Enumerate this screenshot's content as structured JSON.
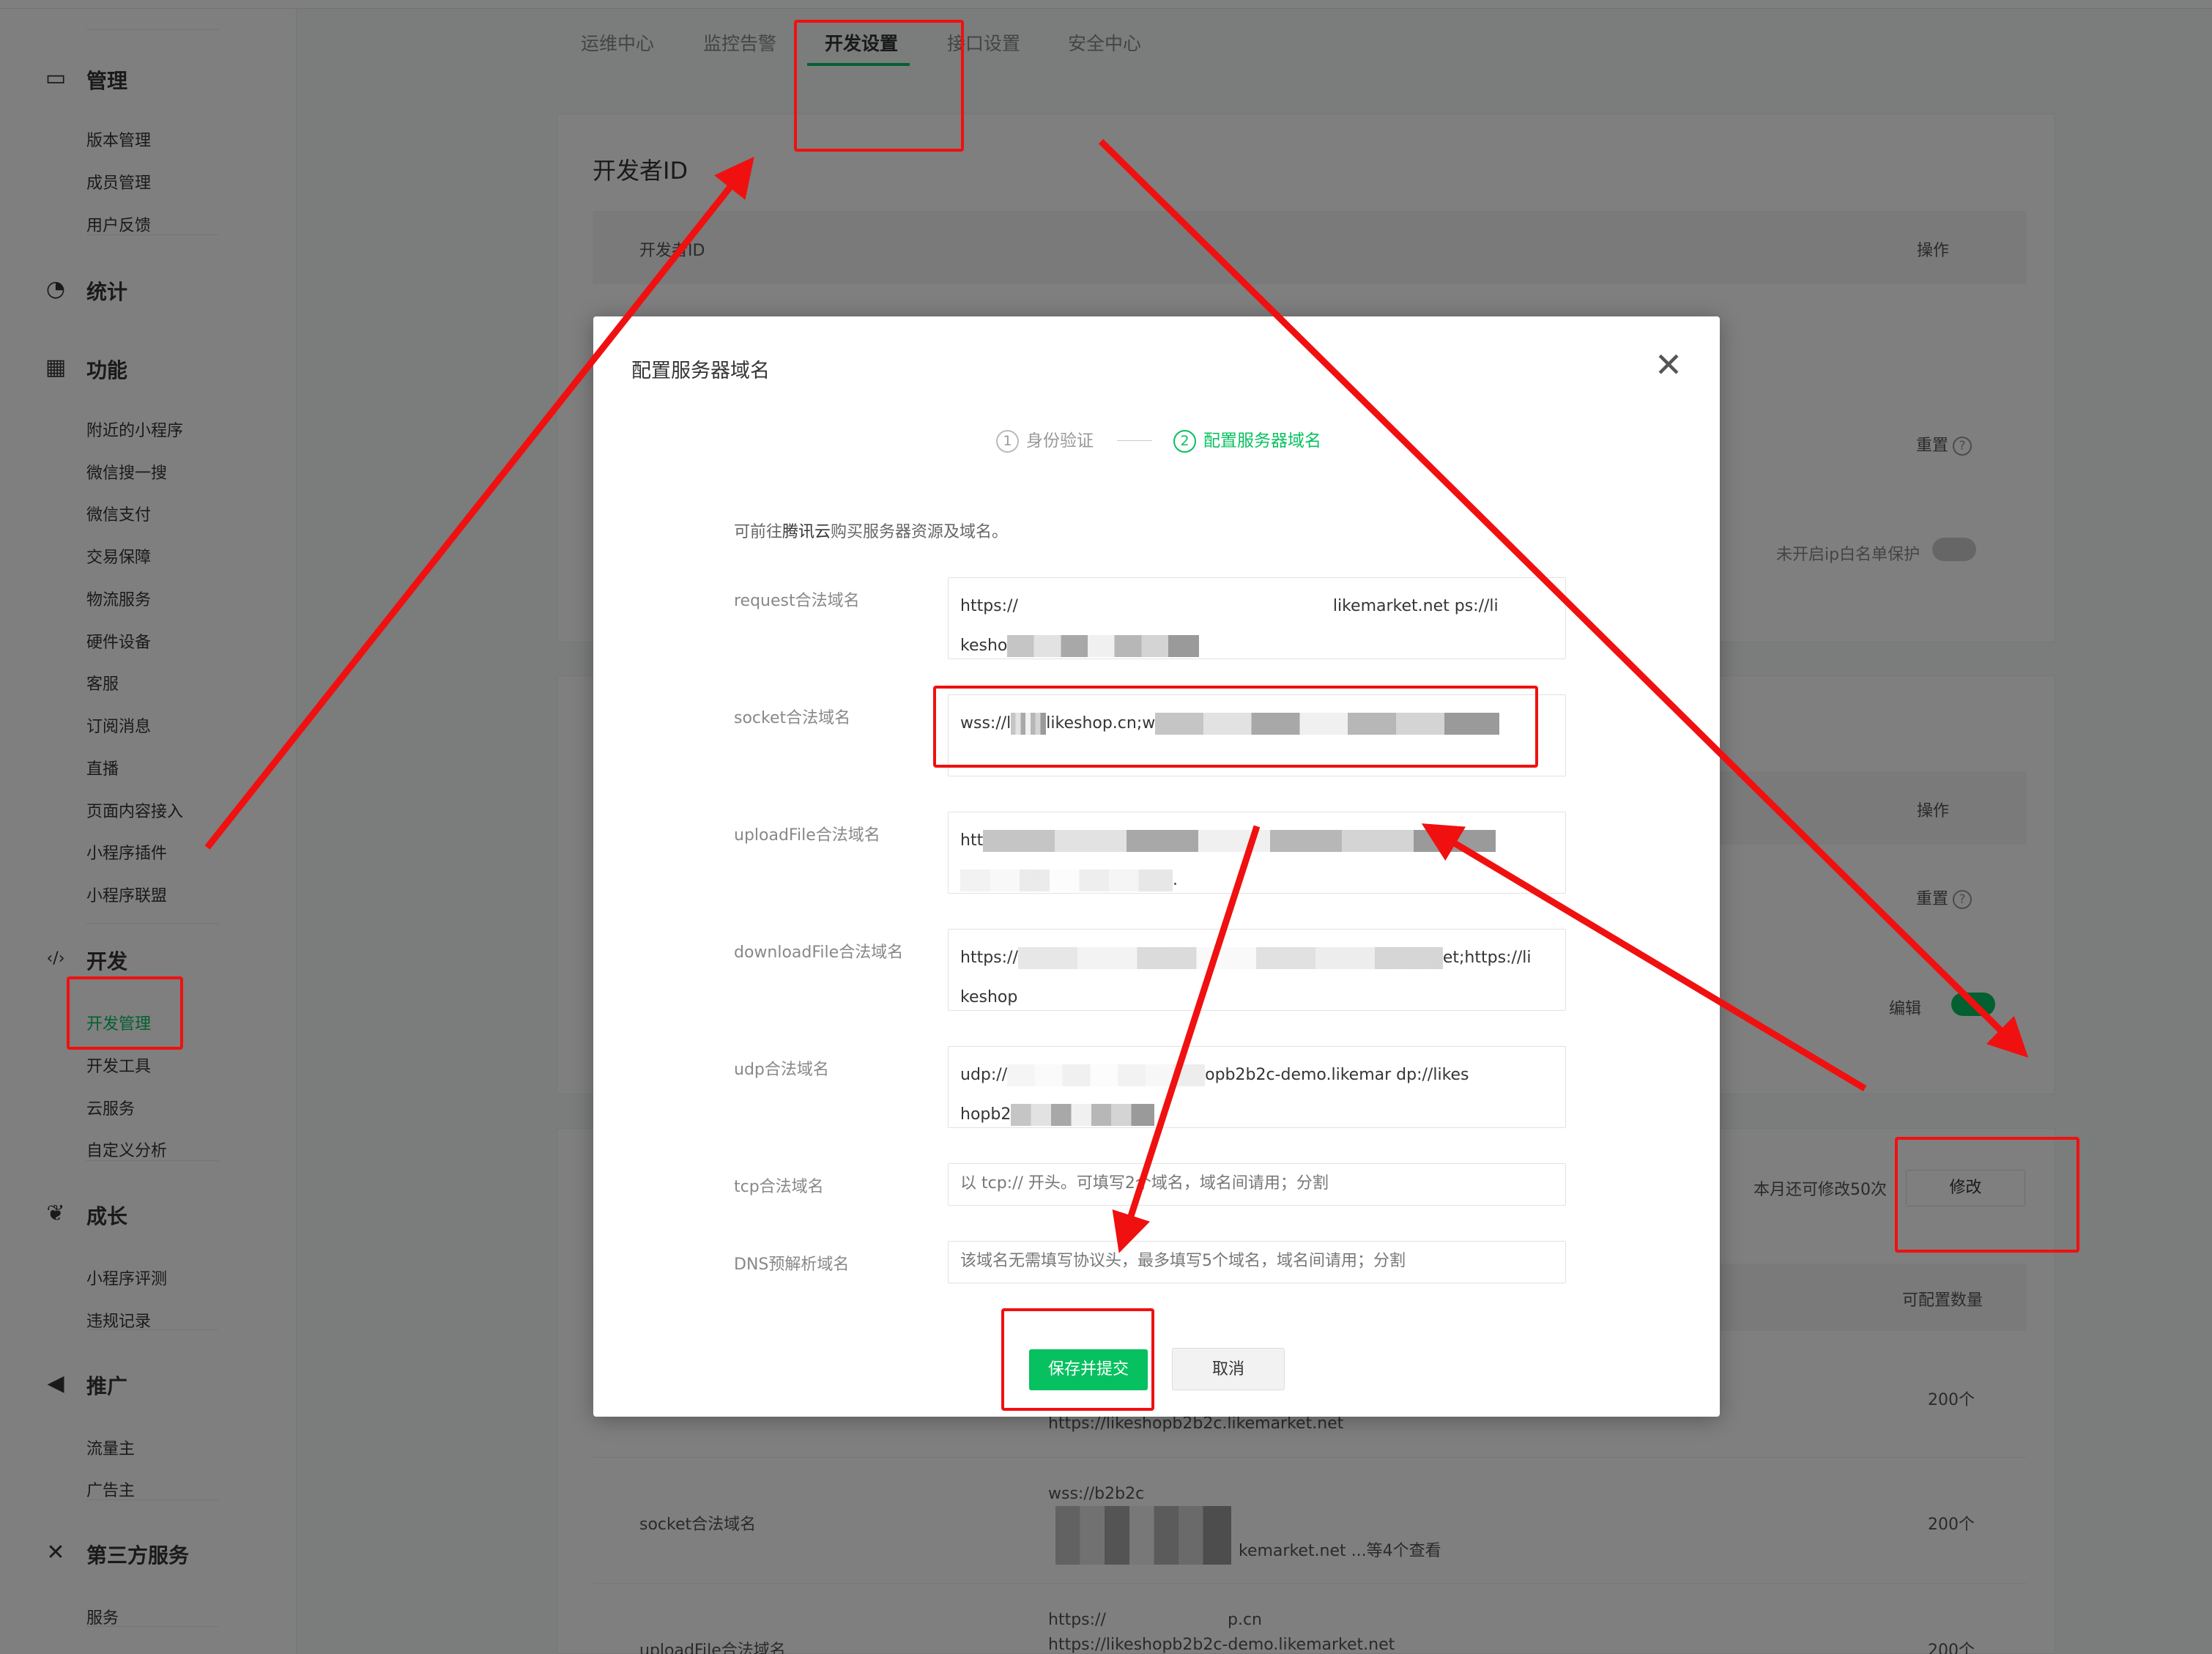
{
  "tabs": [
    "运维中心",
    "监控告警",
    "开发设置",
    "接口设置",
    "安全中心"
  ],
  "sidebar": {
    "sections": [
      {
        "title": "管理",
        "icon": "inbox-icon",
        "items": [
          "版本管理",
          "成员管理",
          "用户反馈"
        ]
      },
      {
        "title": "统计",
        "icon": "pie-chart-icon",
        "items": []
      },
      {
        "title": "功能",
        "icon": "grid-icon",
        "items": [
          "附近的小程序",
          "微信搜一搜",
          "微信支付",
          "交易保障",
          "物流服务",
          "硬件设备",
          "客服",
          "订阅消息",
          "直播",
          "页面内容接入",
          "小程序插件",
          "小程序联盟"
        ]
      },
      {
        "title": "开发",
        "icon": "code-icon",
        "items": [
          "开发管理",
          "开发工具",
          "云服务",
          "自定义分析"
        ]
      },
      {
        "title": "成长",
        "icon": "sprout-icon",
        "items": [
          "小程序评测",
          "违规记录"
        ]
      },
      {
        "title": "推广",
        "icon": "megaphone-icon",
        "items": [
          "流量主",
          "广告主"
        ]
      },
      {
        "title": "第三方服务",
        "icon": "third-party-icon",
        "items": [
          "服务"
        ]
      }
    ]
  },
  "background": {
    "developer_id_title": "开发者ID",
    "developer_id_col": "开发者ID",
    "op_col": "操作",
    "reset": "重置",
    "ip_whitelist": "未开启ip白名单保护",
    "op_col2": "操作",
    "reset2": "重置",
    "edit": "编辑",
    "remaining": "本月还可修改50次",
    "modify": "修改",
    "configurable_count": "可配置数量",
    "rows": [
      {
        "domain": "https://likeshopb2b2c.likemarket.net",
        "count": "200个"
      },
      {
        "label": "socket合法域名",
        "domain_a": "wss://b2b2c",
        "domain_b": "kemarket.net ...等4个查看",
        "count": "200个"
      },
      {
        "label": "uploadFile合法域名",
        "domain_a": "https://",
        "domain_a_tail": "p.cn",
        "domain_b": "https://likeshopb2b2c-demo.likemarket.net",
        "count": "200个"
      }
    ]
  },
  "modal": {
    "title": "配置服务器域名",
    "step1": "身份验证",
    "step1_num": "1",
    "step2": "配置服务器域名",
    "step2_num": "2",
    "hint_pre": "可前往",
    "hint_link": "腾讯云",
    "hint_post": "购买服务器资源及域名。",
    "fields": [
      {
        "label": "request合法域名",
        "value_a": "https://",
        "value_b": "likemarket.net",
        "value_c": "ps://li",
        "value_d": "kesho"
      },
      {
        "label": "socket合法域名",
        "value_a": "wss://l",
        "value_b": "likeshop.cn;w"
      },
      {
        "label": "uploadFile合法域名",
        "value_a": "htt",
        "value_b": "."
      },
      {
        "label": "downloadFile合法域名",
        "value_a": "https://",
        "value_b": "et;https://li",
        "value_c": "keshop"
      },
      {
        "label": "udp合法域名",
        "value_a": "udp://",
        "value_b": "opb2b2c-demo.likemar",
        "value_c": "dp://likes",
        "value_d": "hopb2"
      },
      {
        "label": "tcp合法域名",
        "placeholder": "以 tcp:// 开头。可填写2个域名，域名间请用；分割"
      },
      {
        "label": "DNS预解析域名",
        "placeholder": "该域名无需填写协议头，最多填写5个域名，域名间请用；分割"
      }
    ],
    "save": "保存并提交",
    "cancel": "取消"
  },
  "colors": {
    "brand": "#07c160",
    "annotation": "#f01010"
  }
}
